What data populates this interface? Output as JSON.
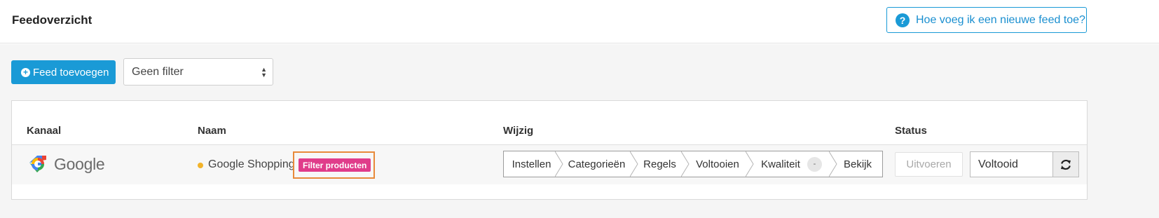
{
  "header": {
    "title": "Feedoverzicht",
    "help_label": "Hoe voeg ik een nieuwe feed toe?",
    "help_icon": "question-circle-icon"
  },
  "toolbar": {
    "add_feed_label": "Feed toevoegen",
    "filter_value": "Geen filter"
  },
  "table": {
    "columns": [
      "Kanaal",
      "Naam",
      "Wijzig",
      "Status"
    ],
    "rows": [
      {
        "channel_logo_text": "Google",
        "name": "Google Shopping",
        "name_status_color": "#f2b32a",
        "filter_badge": "Filter producten",
        "steps": [
          "Instellen",
          "Categorieën",
          "Regels",
          "Voltooien",
          "Kwaliteit",
          "Bekijk"
        ],
        "quality_score": "-",
        "run_label": "Uitvoeren",
        "status": "Voltooid"
      }
    ]
  },
  "colors": {
    "primary": "#1a9ad6",
    "badge_pink": "#e03c8a",
    "highlight_orange": "#e88a3a"
  }
}
